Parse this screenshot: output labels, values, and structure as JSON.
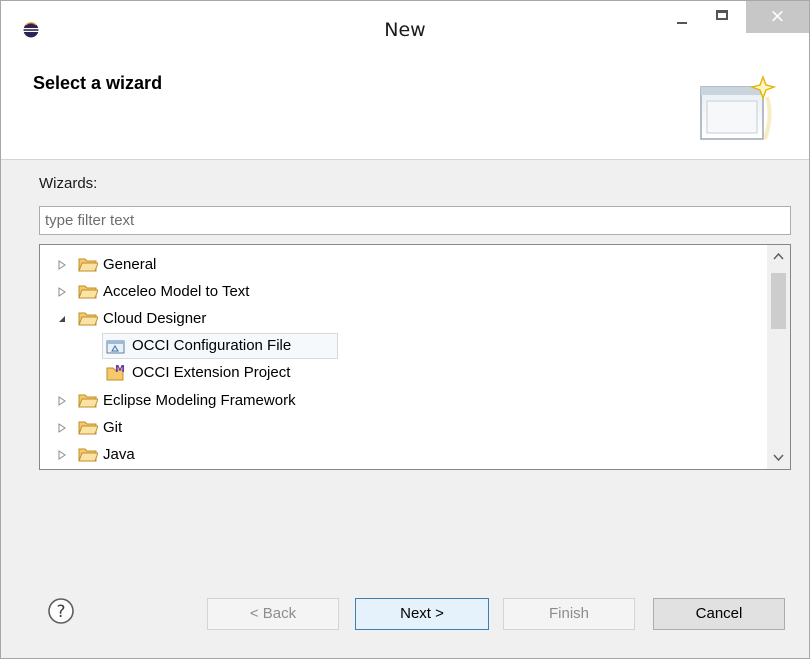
{
  "window": {
    "title": "New"
  },
  "title_buttons": {
    "close_glyph": "×"
  },
  "banner": {
    "title": "Select a wizard",
    "image_icon": "wizard-banner-icon"
  },
  "wizards": {
    "label": "Wizards:",
    "filter_placeholder": "type filter text",
    "filter_value": ""
  },
  "tree": {
    "items": [
      {
        "label": "General",
        "level": 0,
        "expanded": false,
        "icon": "folder-icon"
      },
      {
        "label": "Acceleo Model to Text",
        "level": 0,
        "expanded": false,
        "icon": "folder-icon"
      },
      {
        "label": "Cloud Designer",
        "level": 0,
        "expanded": true,
        "icon": "folder-icon"
      },
      {
        "label": "OCCI Configuration File",
        "level": 1,
        "selected": true,
        "icon": "configuration-file-icon"
      },
      {
        "label": "OCCI Extension Project",
        "level": 1,
        "icon": "extension-project-icon"
      },
      {
        "label": "Eclipse Modeling Framework",
        "level": 0,
        "expanded": false,
        "icon": "folder-icon"
      },
      {
        "label": "Git",
        "level": 0,
        "expanded": false,
        "icon": "folder-icon"
      },
      {
        "label": "Java",
        "level": 0,
        "expanded": false,
        "icon": "folder-icon"
      }
    ]
  },
  "buttons": {
    "back": "< Back",
    "next": "Next >",
    "finish": "Finish",
    "cancel": "Cancel"
  },
  "colors": {
    "folder": "#f5c86b",
    "selection": "#f5f9fc",
    "close_button": "#c7c7c7"
  }
}
